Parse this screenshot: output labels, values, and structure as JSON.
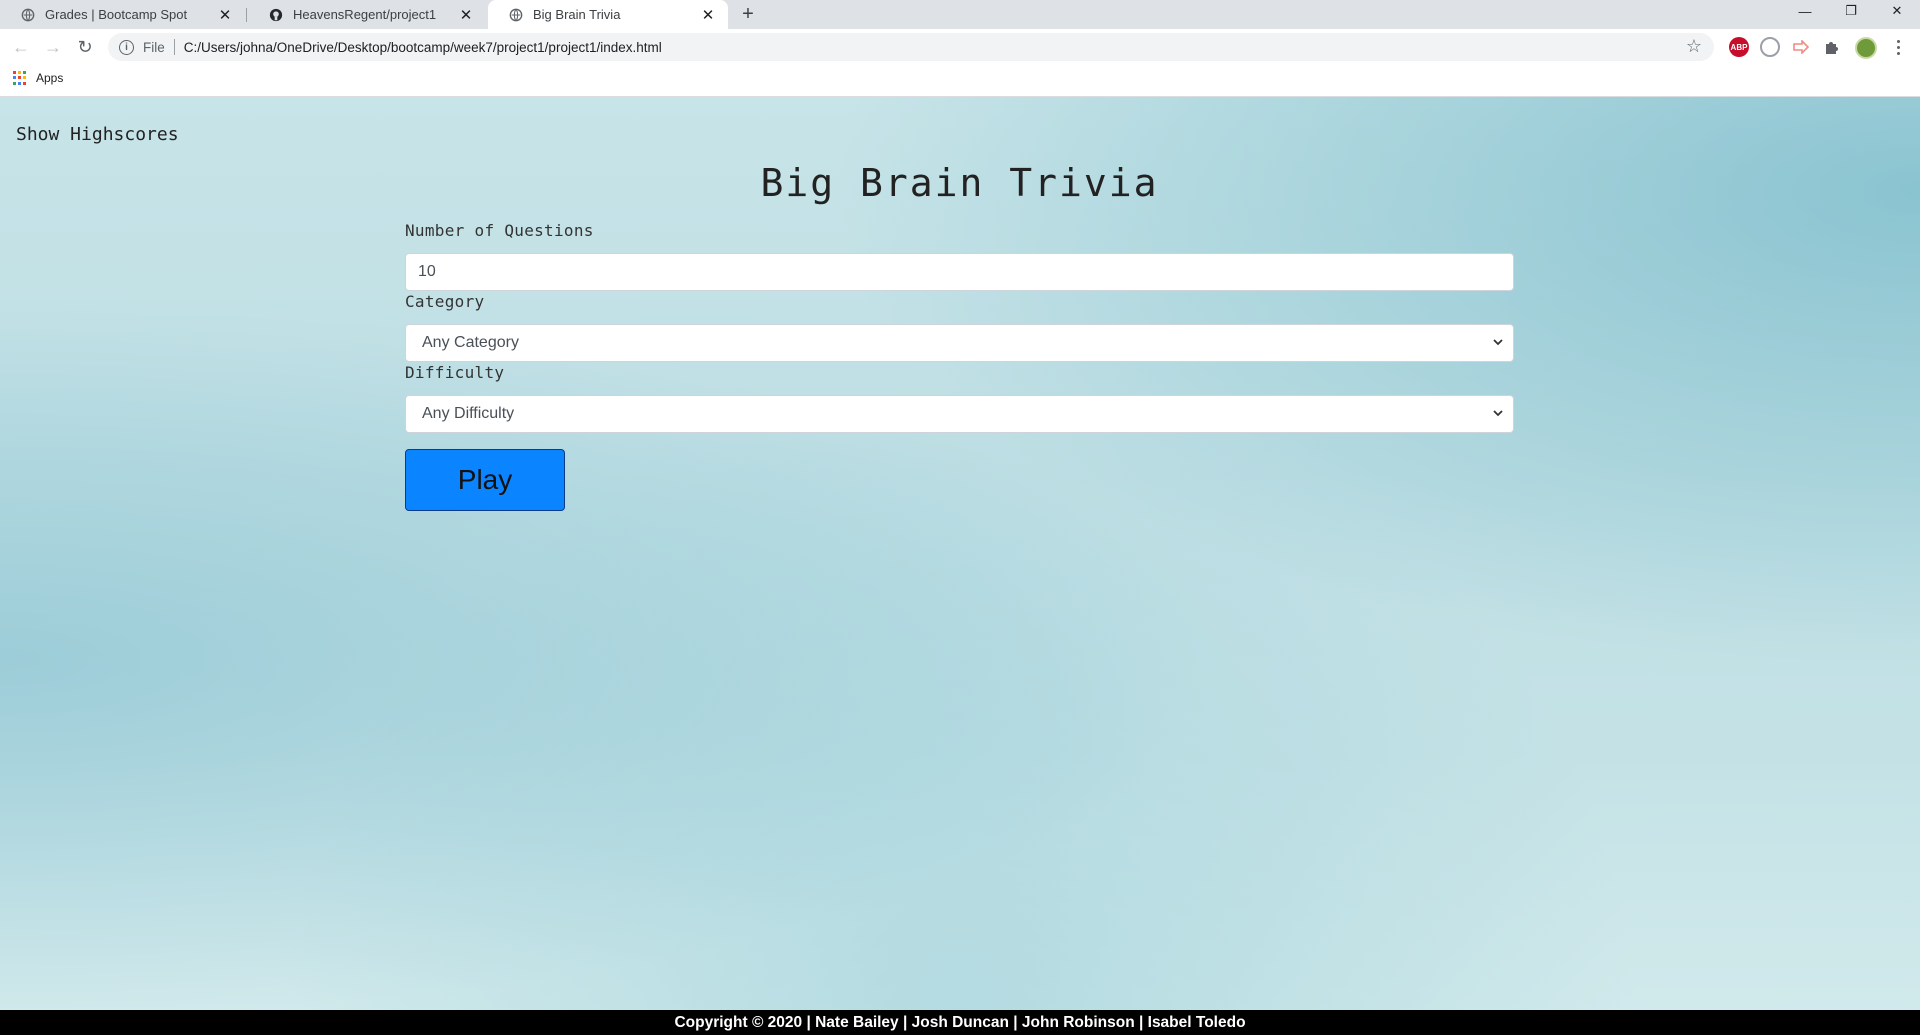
{
  "browser": {
    "tabs": [
      {
        "title": "Grades | Bootcamp Spot",
        "icon": "globe-icon"
      },
      {
        "title": "HeavensRegent/project1",
        "icon": "github-icon"
      },
      {
        "title": "Big Brain Trivia",
        "icon": "globe-icon",
        "active": true
      }
    ],
    "new_tab_label": "+",
    "address": {
      "scheme_label": "File",
      "url": "C:/Users/johna/OneDrive/Desktop/bootcamp/week7/project1/project1/index.html"
    },
    "extensions": [
      {
        "name": "adblock-icon",
        "label": "ABP",
        "color": "#c70d2c"
      },
      {
        "name": "extension-grey-icon",
        "color": "#9aa0a6"
      },
      {
        "name": "extension-red-arrow-icon",
        "color": "#f28b82"
      },
      {
        "name": "puzzle-icon",
        "color": "#5f6368"
      },
      {
        "name": "profile-avatar",
        "color": "#6f9a3a"
      }
    ],
    "bookmarks": {
      "apps_label": "Apps"
    }
  },
  "page": {
    "show_highscores": "Show Highscores",
    "title": "Big Brain Trivia",
    "form": {
      "num_questions_label": "Number of Questions",
      "num_questions_value": "10",
      "category_label": "Category",
      "category_value": "Any Category",
      "difficulty_label": "Difficulty",
      "difficulty_value": "Any Difficulty",
      "play_label": "Play"
    },
    "footer": "Copyright © 2020 | Nate Bailey | Josh Duncan | John Robinson | Isabel Toledo"
  },
  "colors": {
    "play_button": "#0a84ff",
    "background": "#c7e4e8"
  }
}
